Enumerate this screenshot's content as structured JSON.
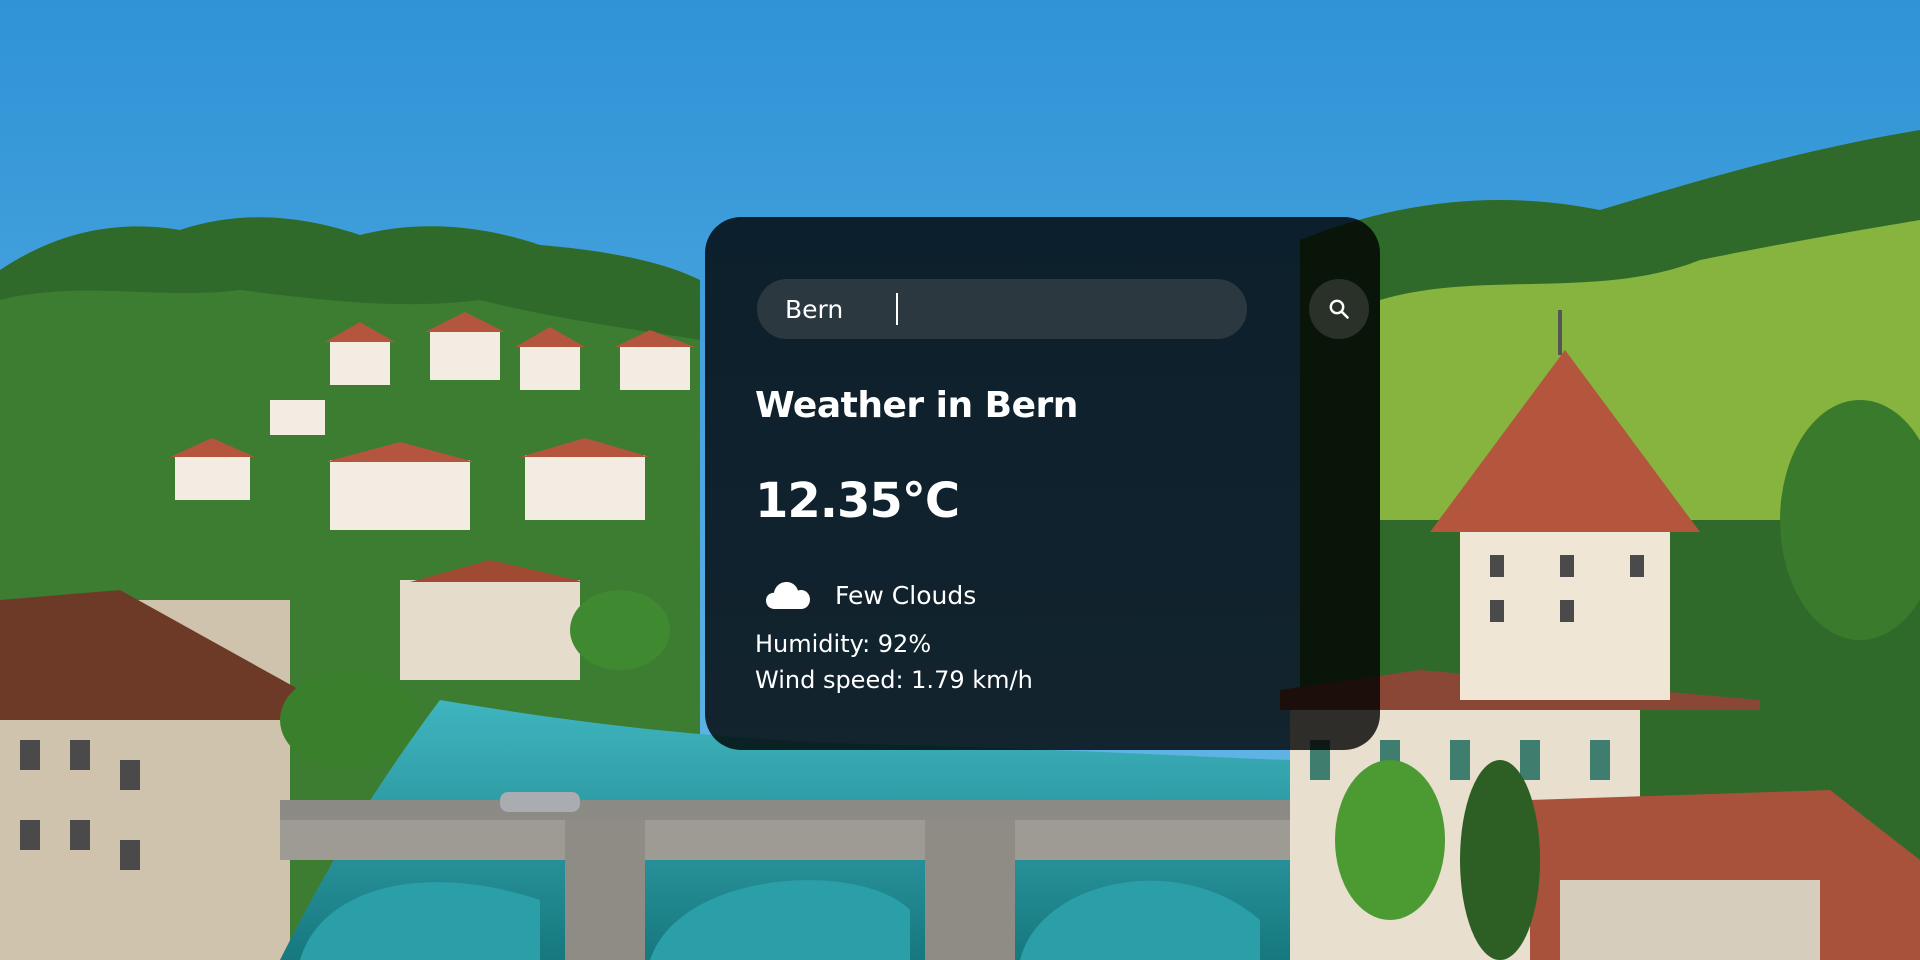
{
  "search": {
    "value": "Bern",
    "icon": "search-icon"
  },
  "weather": {
    "title": "Weather in Bern",
    "temperature": "12.35°C",
    "condition": "Few Clouds",
    "condition_icon": "cloud-icon",
    "humidity": "Humidity: 92%",
    "wind": "Wind speed: 1.79 km/h"
  },
  "colors": {
    "card_background": "#000000",
    "text": "#ffffff",
    "sky": "#4fa9de",
    "river": "#2a9fa8"
  }
}
